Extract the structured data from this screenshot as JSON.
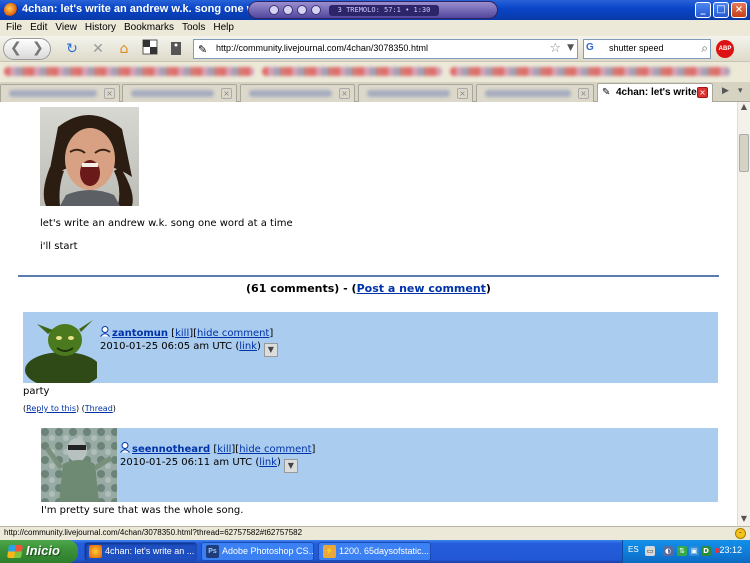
{
  "window": {
    "title": "4chan: let's write an andrew w.k. song one word ...",
    "player_track": "3 TREMOLO: 57:1 • 1:30"
  },
  "menu": [
    "File",
    "Edit",
    "View",
    "History",
    "Bookmarks",
    "Tools",
    "Help"
  ],
  "toolbar": {
    "url": "http://community.livejournal.com/4chan/3078350.html",
    "search_text": "shutter speed",
    "abp_label": "ABP"
  },
  "tabs": {
    "active_label": "4chan: let's write ..."
  },
  "post": {
    "line1": "let's write an andrew w.k. song one word at a time",
    "line2": "i'll start"
  },
  "comments_header": {
    "count_text": "(61 comments) - (",
    "post_link": "Post a new comment",
    "close": ")"
  },
  "comments": [
    {
      "user": "zantomun",
      "kill": "kill",
      "hide": "hide comment",
      "timestamp": "2010-01-25 06:05 am UTC",
      "link": "link",
      "text": "party",
      "reply": "Reply to this",
      "thread": "Thread"
    },
    {
      "user": "seennotheard",
      "kill": "kill",
      "hide": "hide comment",
      "timestamp": "2010-01-25 06:11 am UTC",
      "link": "link",
      "text": "I'm pretty sure that was the whole song."
    }
  ],
  "statusbar": {
    "text": "http://community.livejournal.com/4chan/3078350.html?thread=62757582#t62757582"
  },
  "taskbar": {
    "start": "Inicio",
    "items": [
      "4chan: let's write an ...",
      "Adobe Photoshop CS...",
      "1200. 65daysofstatic..."
    ],
    "lang": "ES",
    "clock": "23:12"
  },
  "colors": {
    "comment_bg": "#aaccee",
    "link": "#0033aa",
    "divider": "#5a7cae"
  }
}
